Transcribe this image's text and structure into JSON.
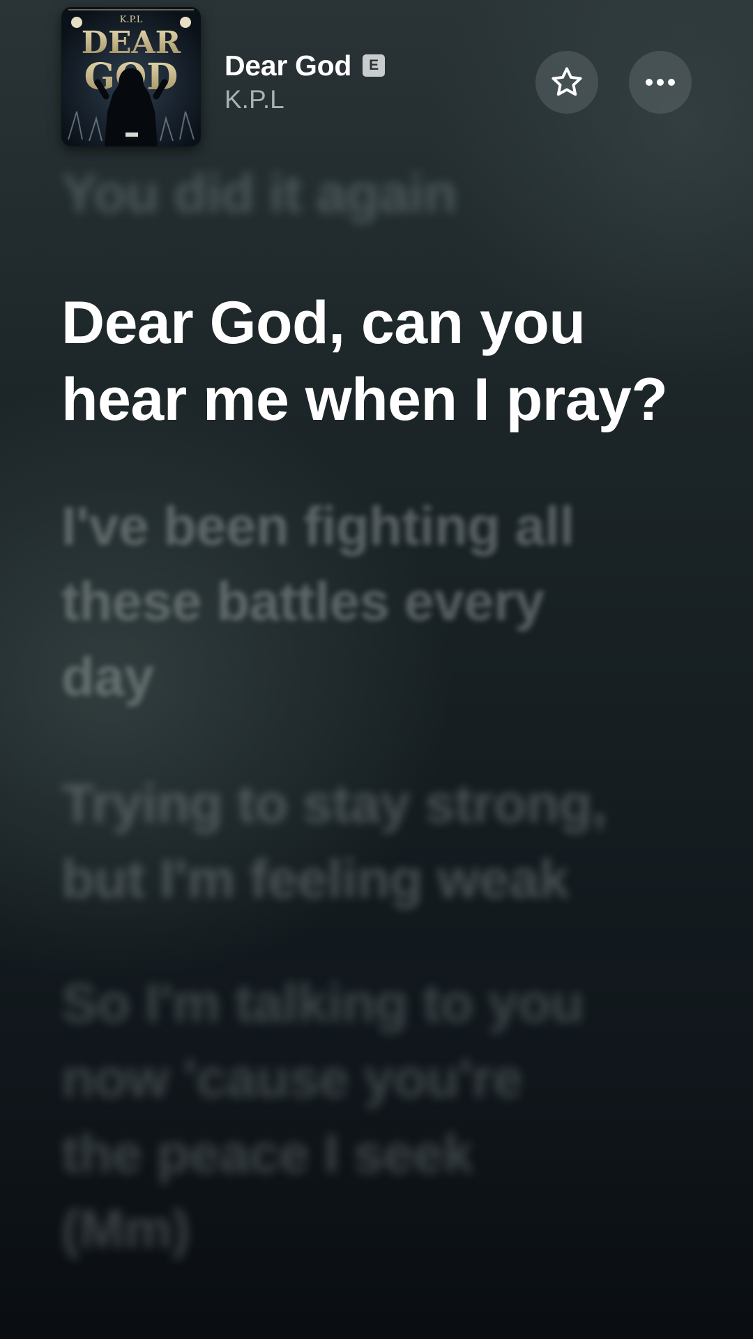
{
  "now_playing": {
    "title": "Dear God",
    "explicit_badge": "E",
    "artist": "K.P.L",
    "artwork": {
      "top_text": "K.P.L",
      "title_line1": "DEAR",
      "title_line2": "GOD"
    }
  },
  "actions": {
    "favorite_icon": "star-outline-icon",
    "more_icon": "ellipsis-icon"
  },
  "lyrics": {
    "previous": [
      "You did it again"
    ],
    "current": [
      "Dear God, can you",
      "hear me when I pray?"
    ],
    "upcoming": [
      [
        "I've been fighting all",
        "these battles every",
        "day"
      ],
      [
        "Trying to stay strong,",
        "but I'm feeling weak"
      ],
      [
        "So I'm talking to you",
        "now 'cause you're",
        "the peace I seek",
        "(Mm)"
      ]
    ]
  },
  "colors": {
    "background_top": "#2a3436",
    "background_bottom": "#0a0e12",
    "current_line": "#ffffff",
    "artist_text": "#aab1b3",
    "badge_bg": "#c9cccd"
  }
}
